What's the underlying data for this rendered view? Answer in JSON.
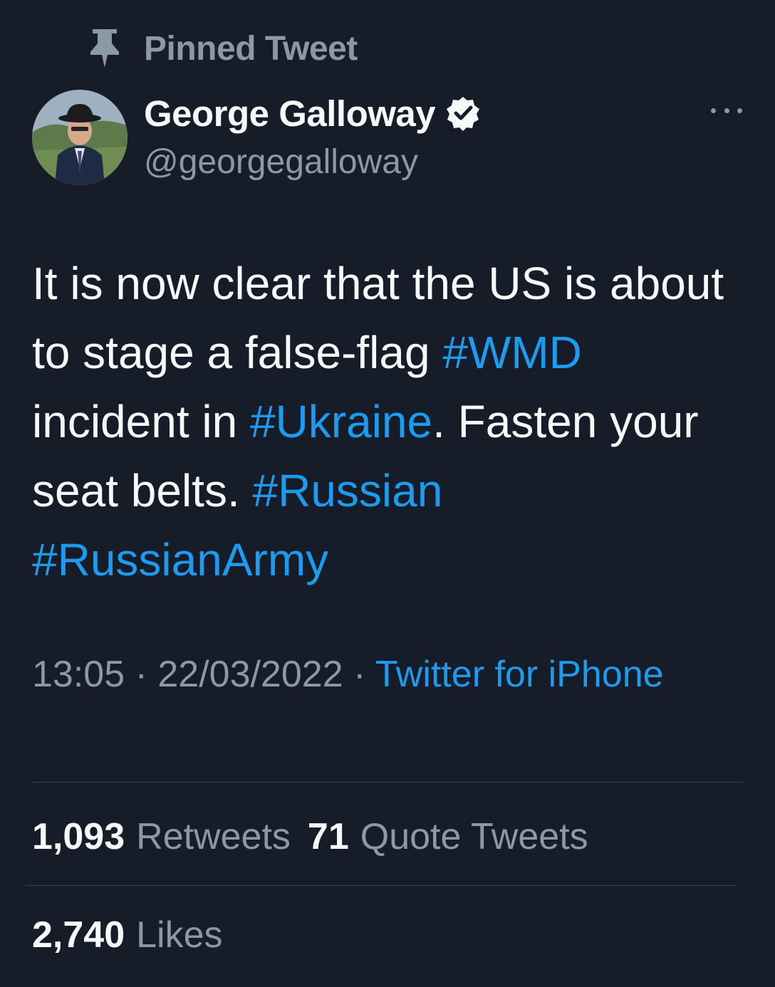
{
  "pinned": {
    "icon": "pin-icon",
    "label": "Pinned Tweet"
  },
  "author": {
    "name": "George Galloway",
    "handle": "@georgegalloway",
    "verified_icon": "verified-badge-icon",
    "avatar_icon": "avatar"
  },
  "more_icon": "more-options-icon",
  "tweet": {
    "segments": [
      {
        "text": "It is now clear that the US is about to stage a false-flag ",
        "hashtag": false
      },
      {
        "text": "#WMD",
        "hashtag": true
      },
      {
        "text": " incident in ",
        "hashtag": false
      },
      {
        "text": "#Ukraine",
        "hashtag": true
      },
      {
        "text": ". Fasten your seat belts. ",
        "hashtag": false
      },
      {
        "text": "#Russian",
        "hashtag": true
      },
      {
        "text": " ",
        "hashtag": false
      },
      {
        "text": "#RussianArmy",
        "hashtag": true
      }
    ]
  },
  "meta": {
    "time": "13:05",
    "separator": " · ",
    "date": "22/03/2022",
    "source": "Twitter for iPhone"
  },
  "stats": {
    "retweets_count": "1,093",
    "retweets_label": "Retweets",
    "quotes_count": "71",
    "quotes_label": "Quote Tweets",
    "likes_count": "2,740",
    "likes_label": "Likes"
  },
  "colors": {
    "background": "#161d28",
    "text": "#f7f9f9",
    "secondary": "#8b98a5",
    "accent": "#1d9bf0",
    "divider": "#38444d"
  }
}
